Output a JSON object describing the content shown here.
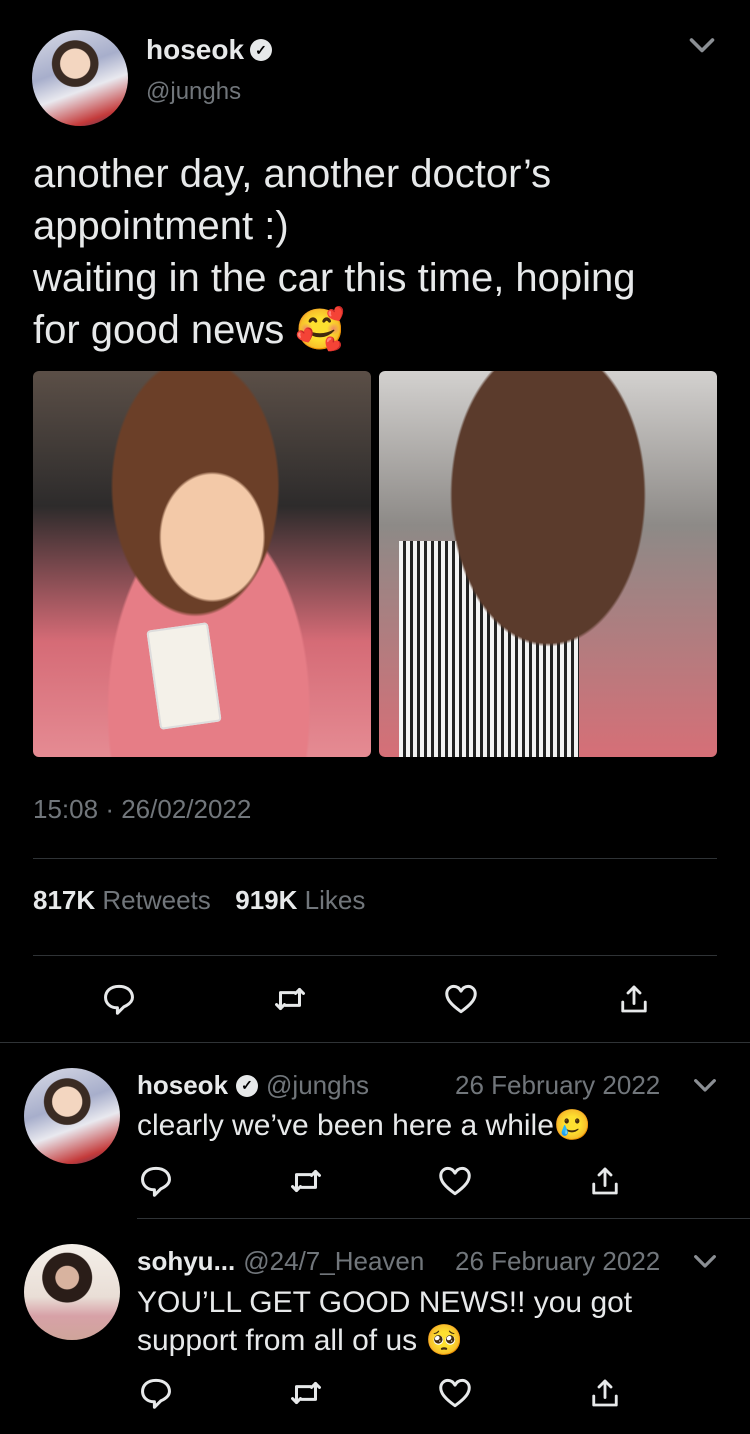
{
  "tweet": {
    "display_name": "hoseok",
    "handle": "@junghs",
    "text_line1": "another day, another doctor’s",
    "text_line2": "appointment :)",
    "text_line3": "waiting in the car this time, hoping",
    "text_line4": "for good news 🥰",
    "time": "15:08",
    "separator": "·",
    "date": "26/02/2022",
    "retweets_count": "817K",
    "retweets_label": "Retweets",
    "likes_count": "919K",
    "likes_label": "Likes"
  },
  "replies": [
    {
      "display_name": "hoseok",
      "handle": "@junghs",
      "date": "26 February 2022",
      "text_line1": "clearly we’ve been here a while🥲"
    },
    {
      "display_name": "sohyu...",
      "handle": "@24/7_Heaven",
      "date": "26 February 2022",
      "text_line1": "YOU’LL GET GOOD NEWS!! you got",
      "text_line2": "support from all of us 🥺"
    }
  ],
  "icons": {
    "reply": "reply-icon",
    "retweet": "retweet-icon",
    "like": "heart-icon",
    "share": "share-icon",
    "more": "chevron-down-icon",
    "verified": "verified-badge-icon"
  },
  "colors": {
    "background": "#000000",
    "text": "#e7e9ea",
    "secondary": "#71767b",
    "divider": "#2f3336"
  }
}
